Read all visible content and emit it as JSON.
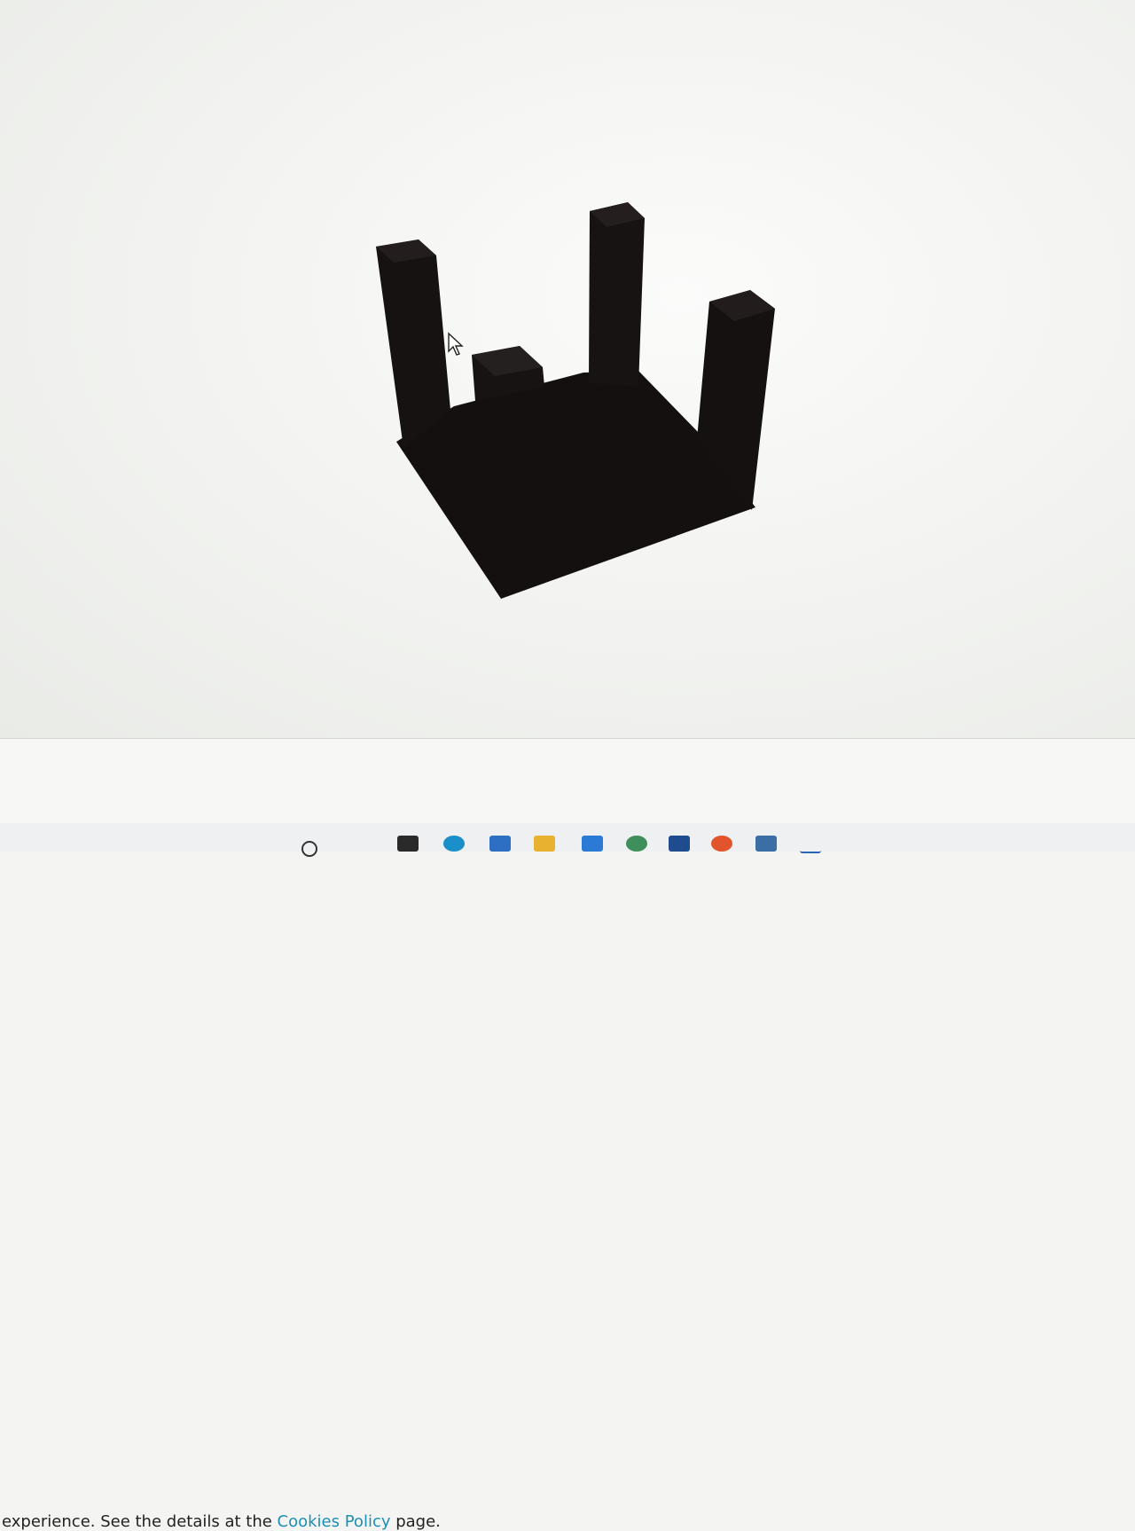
{
  "viewer": {
    "model_color": "#141010",
    "cursor": "arrow-cursor"
  },
  "cookie_notice": {
    "text_before": "experience. See the details at the ",
    "link_text": "Cookies Policy",
    "text_after": " page.",
    "link_color": "#1d8fb3"
  },
  "taskbar": {
    "icons": [
      "search-icon",
      "task-view-icon",
      "edge-icon",
      "store-icon",
      "file-explorer-icon",
      "vscode-icon",
      "app-icon",
      "powershell-icon",
      "firefox-icon",
      "python-icon",
      "pen-icon"
    ]
  }
}
